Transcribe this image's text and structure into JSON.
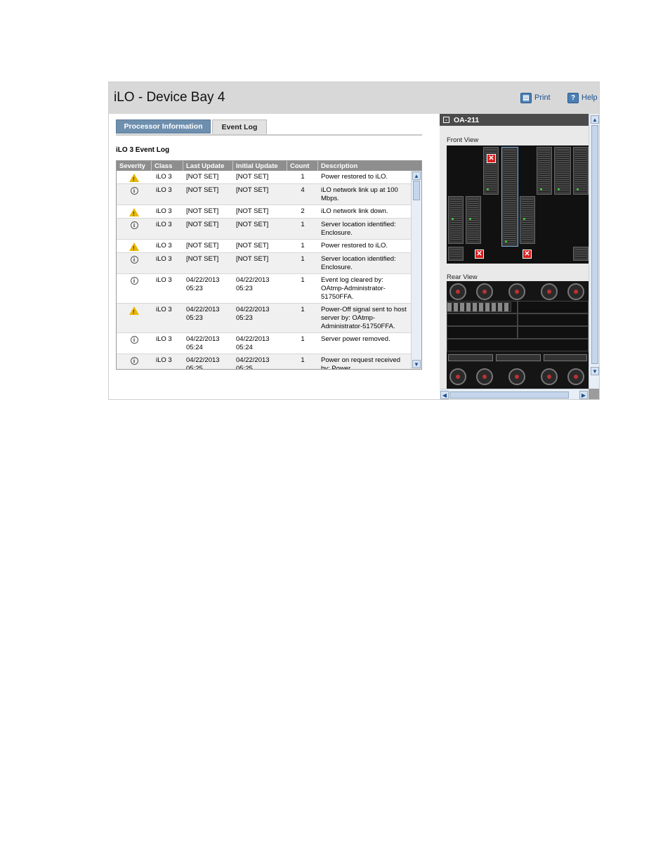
{
  "header": {
    "title": "iLO - Device Bay 4",
    "print_label": "Print",
    "help_label": "Help"
  },
  "tabs": [
    {
      "label": "Processor Information",
      "active": false
    },
    {
      "label": "Event Log",
      "active": true
    }
  ],
  "event_log": {
    "heading": "iLO 3 Event Log",
    "columns": [
      "Severity",
      "Class",
      "Last Update",
      "Initial Update",
      "Count",
      "Description"
    ],
    "rows": [
      {
        "severity": "warning",
        "class": "iLO 3",
        "last_update": "[NOT SET]",
        "initial_update": "[NOT SET]",
        "count": "1",
        "description": "Power restored to iLO."
      },
      {
        "severity": "info",
        "class": "iLO 3",
        "last_update": "[NOT SET]",
        "initial_update": "[NOT SET]",
        "count": "4",
        "description": "iLO network link up at 100 Mbps."
      },
      {
        "severity": "warning",
        "class": "iLO 3",
        "last_update": "[NOT SET]",
        "initial_update": "[NOT SET]",
        "count": "2",
        "description": "iLO network link down."
      },
      {
        "severity": "info",
        "class": "iLO 3",
        "last_update": "[NOT SET]",
        "initial_update": "[NOT SET]",
        "count": "1",
        "description": "Server location identified: Enclosure."
      },
      {
        "severity": "warning",
        "class": "iLO 3",
        "last_update": "[NOT SET]",
        "initial_update": "[NOT SET]",
        "count": "1",
        "description": "Power restored to iLO."
      },
      {
        "severity": "info",
        "class": "iLO 3",
        "last_update": "[NOT SET]",
        "initial_update": "[NOT SET]",
        "count": "1",
        "description": "Server location identified: Enclosure."
      },
      {
        "severity": "info",
        "class": "iLO 3",
        "last_update": "04/22/2013 05:23",
        "initial_update": "04/22/2013 05:23",
        "count": "1",
        "description": "Event log cleared by: OAtmp-Administrator-51750FFA."
      },
      {
        "severity": "warning",
        "class": "iLO 3",
        "last_update": "04/22/2013 05:23",
        "initial_update": "04/22/2013 05:23",
        "count": "1",
        "description": "Power-Off signal sent to host server by: OAtmp-Administrator-51750FFA."
      },
      {
        "severity": "info",
        "class": "iLO 3",
        "last_update": "04/22/2013 05:24",
        "initial_update": "04/22/2013 05:24",
        "count": "1",
        "description": "Server power removed."
      },
      {
        "severity": "info",
        "class": "iLO 3",
        "last_update": "04/22/2013 05:25",
        "initial_update": "04/22/2013 05:25",
        "count": "1",
        "description": "Power on request received by: Power"
      }
    ]
  },
  "enclosure": {
    "name": "OA-211",
    "front_view_label": "Front View",
    "rear_view_label": "Rear View"
  },
  "colors": {
    "header_bg": "#d8d8d8",
    "tab_inactive_bg": "#6f8fae",
    "table_header_bg": "#8e8e8e",
    "warning": "#e8b800",
    "error": "#d81e1e"
  }
}
